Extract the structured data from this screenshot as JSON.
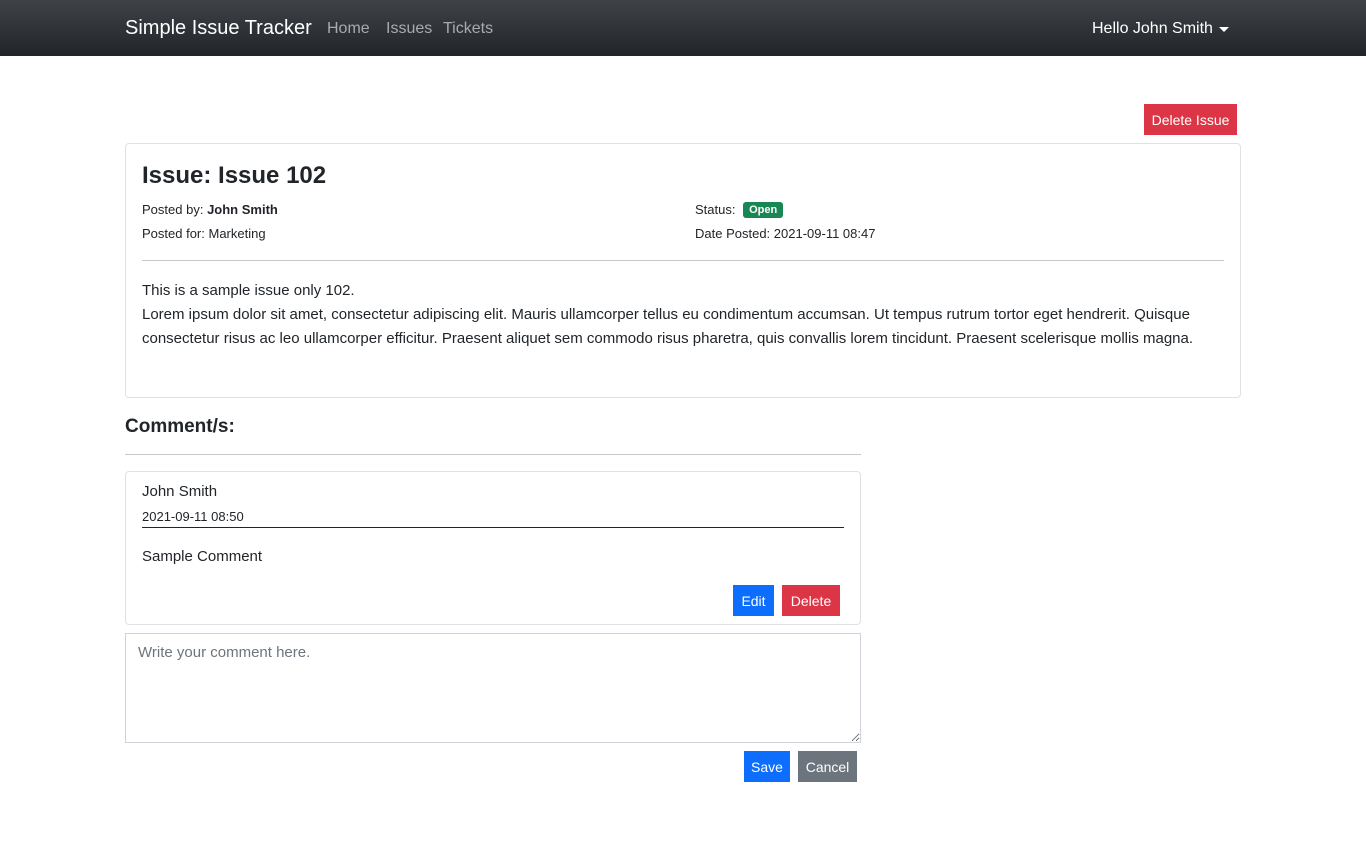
{
  "navbar": {
    "brand": "Simple Issue Tracker",
    "links": [
      "Home",
      "Issues",
      "Tickets"
    ],
    "user_greeting": "Hello John Smith"
  },
  "issue": {
    "delete_label": "Delete Issue",
    "title": "Issue: Issue 102",
    "posted_by_label": "Posted by:",
    "posted_by": "John Smith",
    "posted_for_label": "Posted for:",
    "posted_for": "Marketing",
    "status_label": "Status:",
    "status": "Open",
    "date_label": "Date Posted:",
    "date": "2021-09-11 08:47",
    "description_line1": "This is a sample issue only 102.",
    "description_line2": "Lorem ipsum dolor sit amet, consectetur adipiscing elit. Mauris ullamcorper tellus eu condimentum accumsan. Ut tempus rutrum tortor eget hendrerit. Quisque consectetur risus ac leo ullamcorper efficitur. Praesent aliquet sem commodo risus pharetra, quis convallis lorem tincidunt. Praesent scelerisque mollis magna."
  },
  "comments": {
    "heading": "Comment/s:",
    "items": [
      {
        "author": "John Smith",
        "date": "2021-09-11 08:50",
        "text": "Sample Comment",
        "edit_label": "Edit",
        "delete_label": "Delete"
      }
    ],
    "input_placeholder": "Write your comment here.",
    "save_label": "Save",
    "cancel_label": "Cancel"
  },
  "colors": {
    "danger": "#dc3545",
    "primary": "#0d6efd",
    "secondary": "#6c757d",
    "success": "#198754",
    "navbar": "#212529"
  }
}
